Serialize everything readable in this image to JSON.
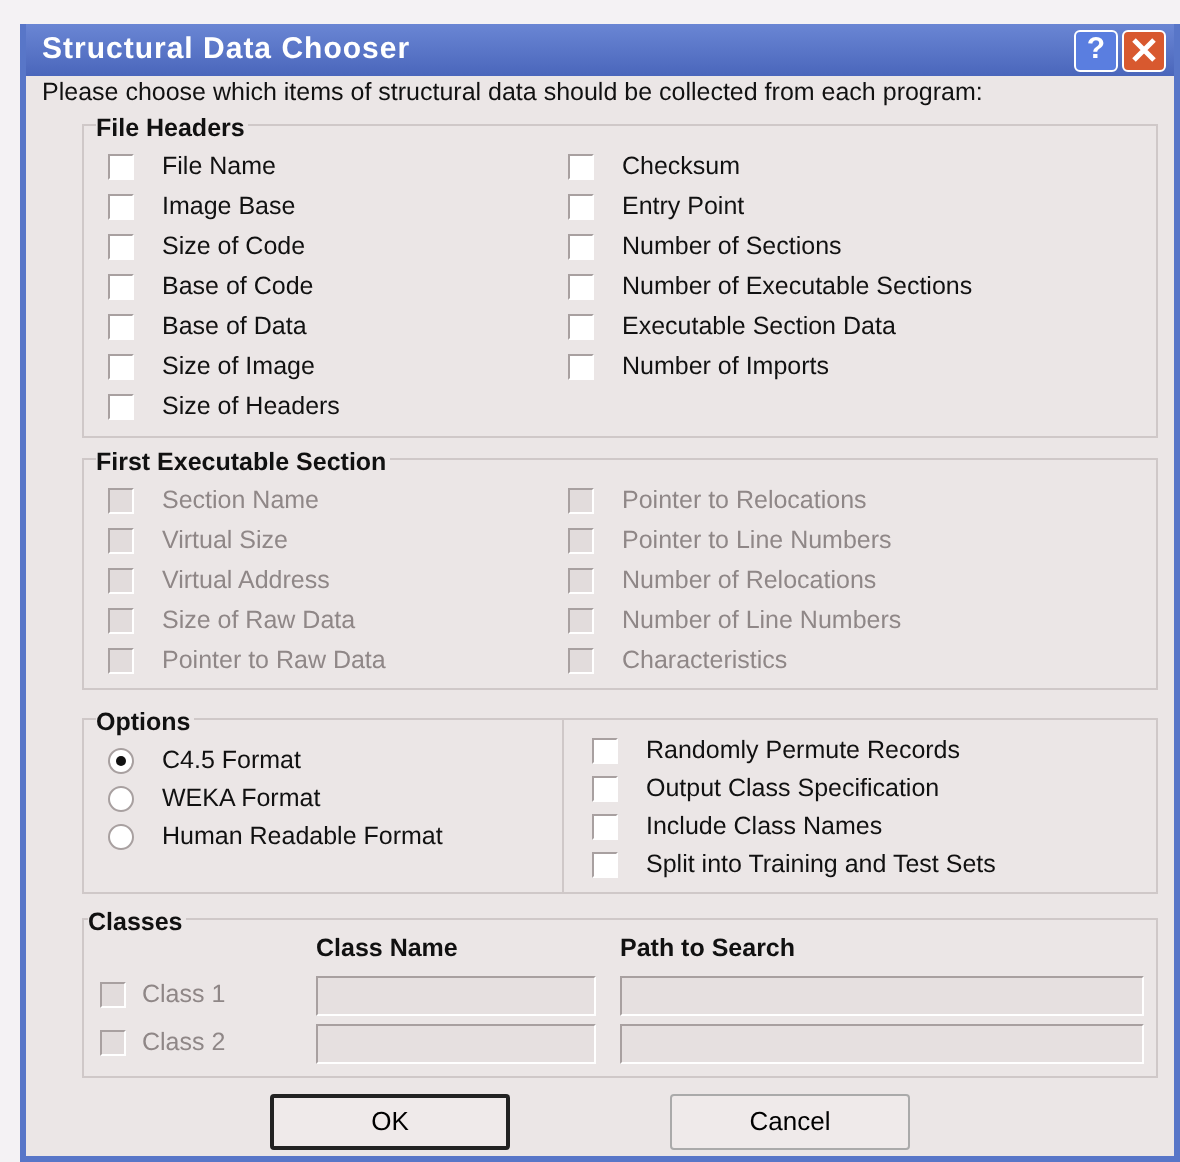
{
  "window": {
    "title": "Structural Data Chooser",
    "help": "?"
  },
  "intro": "Please choose which items of structural data should be collected from each program:",
  "groups": [
    {
      "title": "File Headers",
      "disabled": false,
      "columns": [
        [
          {
            "label": "File Name",
            "checked": false
          },
          {
            "label": "Image Base",
            "checked": false
          },
          {
            "label": "Size of Code",
            "checked": false
          },
          {
            "label": "Base of Code",
            "checked": false
          },
          {
            "label": "Base of Data",
            "checked": false
          },
          {
            "label": "Size of Image",
            "checked": false
          },
          {
            "label": "Size of Headers",
            "checked": false
          }
        ],
        [
          {
            "label": "Checksum",
            "checked": false
          },
          {
            "label": "Entry Point",
            "checked": false
          },
          {
            "label": "Number of Sections",
            "checked": false
          },
          {
            "label": "Number of Executable Sections",
            "checked": false
          },
          {
            "label": "Executable Section Data",
            "checked": false
          },
          {
            "label": "Number of Imports",
            "checked": false
          }
        ]
      ]
    },
    {
      "title": "First Executable Section",
      "disabled": true,
      "columns": [
        [
          {
            "label": "Section Name",
            "checked": false
          },
          {
            "label": "Virtual Size",
            "checked": false
          },
          {
            "label": "Virtual Address",
            "checked": false
          },
          {
            "label": "Size of Raw Data",
            "checked": false
          },
          {
            "label": "Pointer to Raw Data",
            "checked": false
          }
        ],
        [
          {
            "label": "Pointer to Relocations",
            "checked": false
          },
          {
            "label": "Pointer to Line Numbers",
            "checked": false
          },
          {
            "label": "Number of Relocations",
            "checked": false
          },
          {
            "label": "Number of Line Numbers",
            "checked": false
          },
          {
            "label": "Characteristics",
            "checked": false
          }
        ]
      ]
    }
  ],
  "options": {
    "title": "Options",
    "formats": [
      {
        "label": "C4.5 Format",
        "selected": true
      },
      {
        "label": "WEKA Format",
        "selected": false
      },
      {
        "label": "Human Readable Format",
        "selected": false
      }
    ],
    "flags": [
      {
        "label": "Randomly Permute Records",
        "checked": false
      },
      {
        "label": "Output Class Specification",
        "checked": false
      },
      {
        "label": "Include Class Names",
        "checked": false
      },
      {
        "label": "Split into Training and Test Sets",
        "checked": false
      }
    ]
  },
  "classes": {
    "title": "Classes",
    "disabled": true,
    "name_header": "Class Name",
    "path_header": "Path to Search",
    "rows": [
      {
        "label": "Class 1",
        "checked": false
      },
      {
        "label": "Class 2",
        "checked": false
      }
    ]
  },
  "buttons": [
    {
      "label": "OK",
      "default": true
    },
    {
      "label": "Cancel",
      "default": false
    }
  ]
}
